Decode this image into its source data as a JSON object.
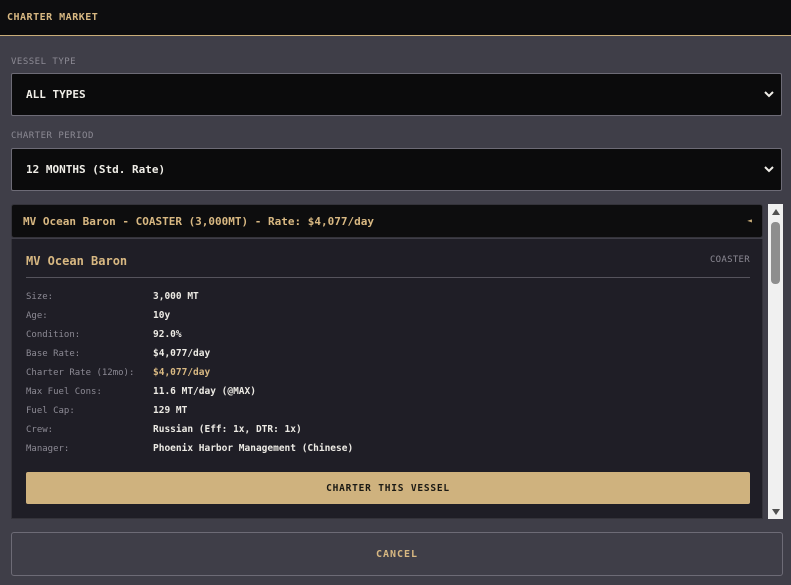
{
  "header": {
    "title": "CHARTER MARKET"
  },
  "filters": {
    "vessel_type": {
      "label": "VESSEL TYPE",
      "selected": "ALL TYPES"
    },
    "charter_period": {
      "label": "CHARTER PERIOD",
      "selected": "12 MONTHS (Std. Rate)"
    }
  },
  "listing": {
    "summary": "MV Ocean Baron - COASTER (3,000MT) - Rate: $4,077/day",
    "toggle_glyph": "◄",
    "detail": {
      "name": "MV Ocean Baron",
      "type": "COASTER",
      "rows": [
        {
          "label": "Size:",
          "value": "3,000 MT"
        },
        {
          "label": "Age:",
          "value": "10y"
        },
        {
          "label": "Condition:",
          "value": "92.0%"
        },
        {
          "label": "Base Rate:",
          "value": "$4,077/day"
        },
        {
          "label": "Charter Rate (12mo):",
          "value": "$4,077/day"
        },
        {
          "label": "Max Fuel Cons:",
          "value": "11.6 MT/day (@MAX)"
        },
        {
          "label": "Fuel Cap:",
          "value": "129 MT"
        },
        {
          "label": "Crew:",
          "value": "Russian (Eff: 1x, DTR: 1x)"
        },
        {
          "label": "Manager:",
          "value": "Phoenix Harbor Management (Chinese)"
        }
      ],
      "charter_button": "CHARTER THIS VESSEL"
    }
  },
  "actions": {
    "cancel_label": "CANCEL"
  },
  "colors": {
    "accent": "#d8b882",
    "button_bg": "#cfb27e",
    "panel_bg": "#1f1e26",
    "page_bg": "#3f3e48"
  }
}
